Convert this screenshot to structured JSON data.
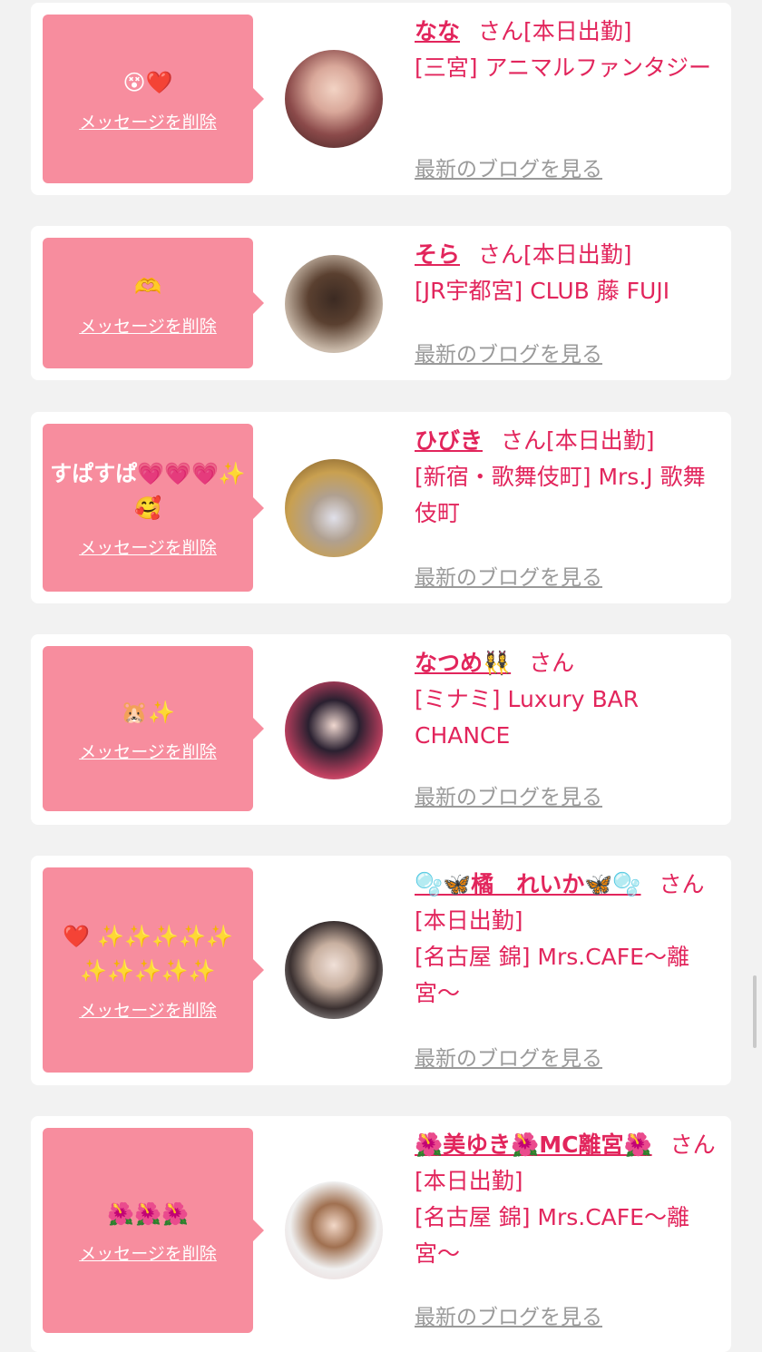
{
  "delete_label": "メッセージを削除",
  "blog_label": "最新のブログを見る",
  "san_label": "さん",
  "cards": [
    {
      "message": "😵❤️",
      "name": "なな",
      "status": "[本日出勤]",
      "shop": "[三宮] アニマルファンタジー"
    },
    {
      "message": "🫶",
      "name": "そら",
      "status": "[本日出勤]",
      "shop": "[JR宇都宮] CLUB 藤 FUJI"
    },
    {
      "message": "すぱすぱ💗💗💗✨🥰",
      "name": "ひびき",
      "status": "[本日出勤]",
      "shop": "[新宿・歌舞伎町] Mrs.J 歌舞伎町"
    },
    {
      "message": "🐹✨",
      "name": "なつめ👯‍♀️",
      "status": "",
      "shop": "[ミナミ] Luxury BAR CHANCE"
    },
    {
      "message": "❤️ ✨✨✨✨✨✨✨✨✨✨",
      "name": "🫧🦋橘　れいか🦋🫧",
      "status": "[本日出勤]",
      "shop": "[名古屋 錦] Mrs.CAFE〜離宮〜"
    },
    {
      "message": "🌺🌺🌺",
      "name": "🌺美ゆき🌺MC離宮🌺",
      "status": "[本日出勤]",
      "shop": "[名古屋 錦] Mrs.CAFE〜離宮〜"
    }
  ],
  "colors": {
    "accent": "#e2255c",
    "bubble": "#f78d9e",
    "background": "#f2f2f2"
  }
}
